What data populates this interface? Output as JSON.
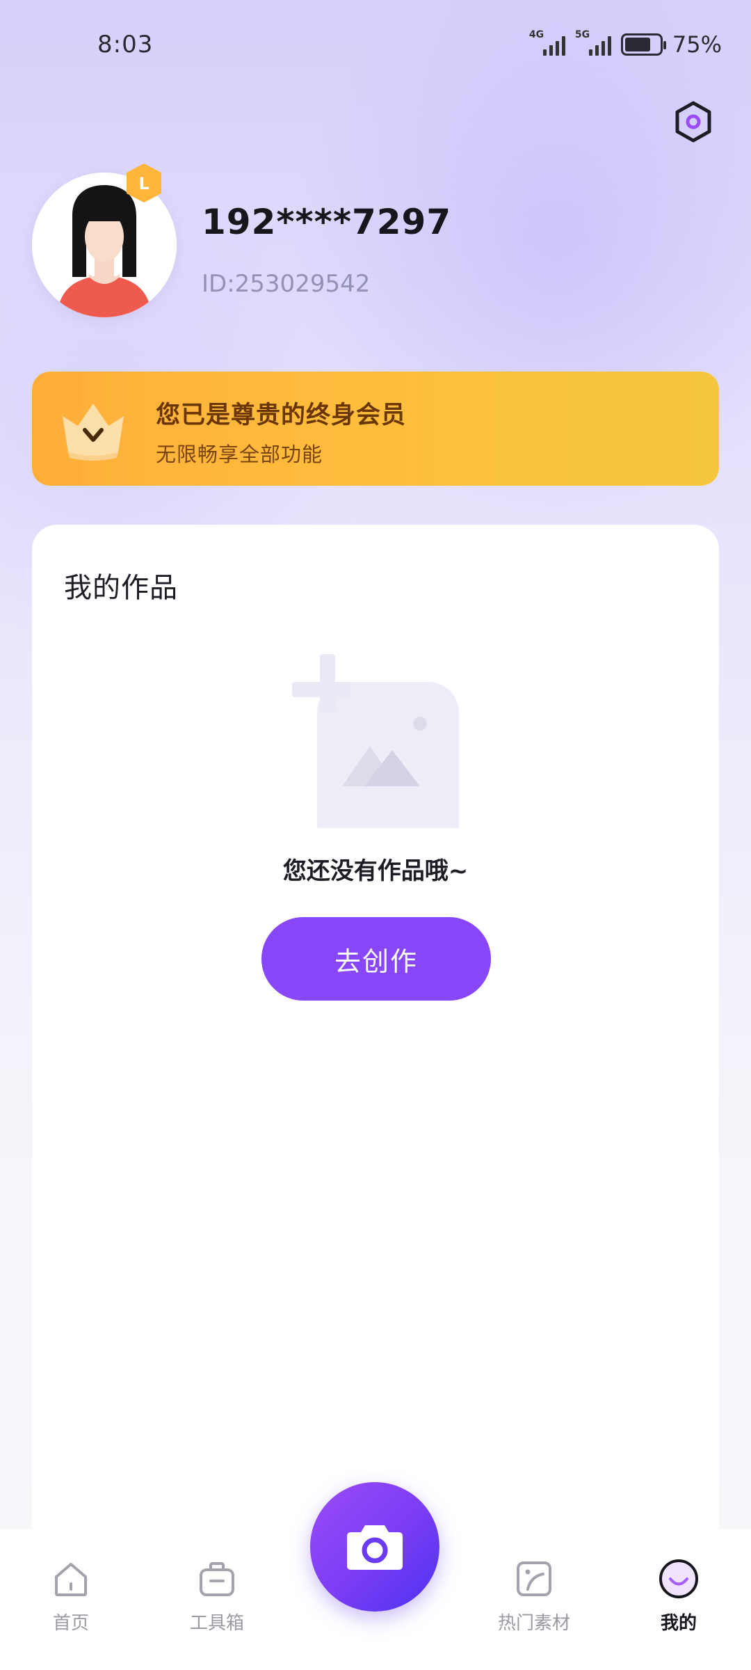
{
  "status_bar": {
    "time": "8:03",
    "network_1": "4G",
    "network_2": "5G",
    "battery_percent": "75%",
    "battery_level": 0.75
  },
  "profile": {
    "username": "192****7297",
    "user_id": "ID:253029542",
    "vip_badge_letter": "L"
  },
  "vip_banner": {
    "title": "您已是尊贵的终身会员",
    "subtitle": "无限畅享全部功能"
  },
  "works": {
    "section_title": "我的作品",
    "empty_message": "您还没有作品哦~",
    "create_button": "去创作"
  },
  "bottom_nav": {
    "items": [
      {
        "label": "首页",
        "icon": "home-icon",
        "active": false
      },
      {
        "label": "工具箱",
        "icon": "toolbox-icon",
        "active": false
      },
      {
        "label": "热门素材",
        "icon": "hot-material-icon",
        "active": false
      },
      {
        "label": "我的",
        "icon": "profile-icon",
        "active": true
      }
    ],
    "center_button_icon": "camera-icon"
  },
  "colors": {
    "accent": "#8746f7",
    "vip_gold": "#ffbd3c",
    "background_top": "#d6d0fb"
  }
}
